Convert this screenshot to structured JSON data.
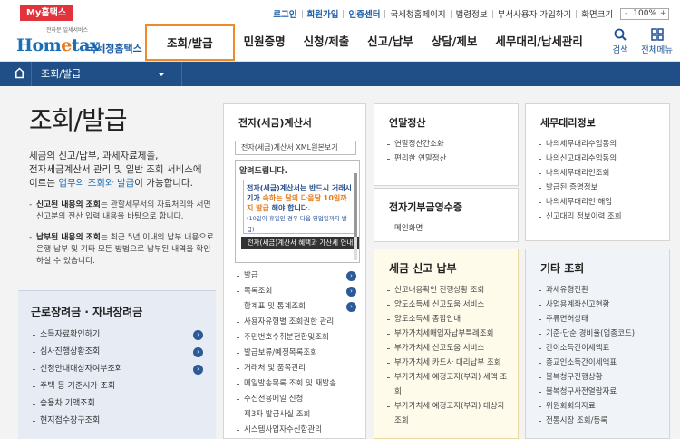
{
  "top": {
    "my_tab": "My홈택스",
    "links": [
      "로그인",
      "회원가입",
      "인증센터",
      "국세청홈페이지",
      "법령정보",
      "부서사용자 가입하기",
      "화면크기"
    ],
    "zoom_value": "100%",
    "zoom_minus": "-",
    "zoom_plus": "+"
  },
  "gnb": {
    "logo_small": "전하문 일세서비스",
    "logo_main_a": "Hom",
    "logo_main_e": "e",
    "logo_main_b": "tax",
    "logo_sub": "국세청홈택스",
    "menu": [
      "조회/발급",
      "민원증명",
      "신청/제출",
      "신고/납부",
      "상담/제보",
      "세무대리/납세관리"
    ],
    "search_label": "검색",
    "allmenu_label": "전체메뉴"
  },
  "location": {
    "title": "조회/발급"
  },
  "intro": {
    "title": "조회/발급",
    "desc_1": "세금의 신고/납부, 과세자료제출,",
    "desc_2": "전자세금계산서 관리 및 일반 조회 서비스에",
    "desc_3_a": "이르는 ",
    "desc_3_b": "업무의 조회와 발급",
    "desc_3_c": "이 가능합니다.",
    "bullet1_bold": "신고된 내용의 조회",
    "bullet1_text": "는 관할세무서의 자료처리와 서면신고분의 전산 입력 내용을 바탕으로 합니다.",
    "bullet2_bold": "납부된 내용의 조회",
    "bullet2_text": "는 최근 5년 이내의 납부 내용으로 은행 납부 및 기타 모든 방법으로 납부된 내역을 확인하실 수 있습니다."
  },
  "sub_box": {
    "title": "근로장려금 · 자녀장려금",
    "items": [
      "소득자료확인하기",
      "심사진행상황조회",
      "신청안내대상자여부조회",
      "주택 등 기준시가 조회",
      "승용차 기액조회",
      "현지접수장구조회"
    ]
  },
  "col1": {
    "title": "전자(세금)계산서",
    "search": "전자(세금)계산서 XML원본보기",
    "notice_title": "알려드립니다.",
    "notice_a": "전자(세금)계산서는 반드시 거래시기가 ",
    "notice_b": "속하는 달의 다음달 10일까지 발급",
    "notice_c": " 해야 합니다.",
    "notice_small": "(10일이 휴일인 경우 다음 영업일까지 발급)",
    "notice_bar": "전자(세금)계산서 혜택과 가산세 안내",
    "items": [
      "발급",
      "목록조회",
      "합계표 및 통계조회",
      "사용자유형별 조회권한 관리",
      "주민번호수취분전환및조회",
      "발급보류/예정목록조회",
      "거래처 및 품목관리",
      "메일발송목록 조회 및 재발송",
      "수신전용메일 신청",
      "제3자 발급사실 조회",
      "시스템사업자수신함관리"
    ]
  },
  "col2a": {
    "title": "연말정산",
    "items": [
      "연말정산간소화",
      "편리한 연말정산"
    ]
  },
  "col2b": {
    "title": "전자기부금영수증",
    "items": [
      "메인화면"
    ]
  },
  "col2c": {
    "title": "세금 신고 납부",
    "items": [
      "신고내용확인 진행상황 조회",
      "양도소득세 신고도움 서비스",
      "양도소득세 종합안내",
      "부가가치세매입자납부특례조회",
      "부가가치세 신고도움 서비스",
      "부가가치세 카드사 대리납부 조회",
      "부가가치세 예정고지(부과) 세액 조회",
      "부가가치세 예정고지(부과) 대상자 조회"
    ]
  },
  "col3a": {
    "title": "세무대리정보",
    "items": [
      "나의세무대리수임동의",
      "나의신고대리수임동의",
      "나의세무대리인조회",
      "발급된 증명정보",
      "나의세무대리인 해임",
      "신고대리 정보이력 조회"
    ]
  },
  "col3b": {
    "title": "기타 조회",
    "items": [
      "과세유형전환",
      "사업용계좌신고현황",
      "주류면허상태",
      "기준·단순 경비율(업종코드)",
      "간이소득간이세액표",
      "종교인소득간이세액표",
      "불복청구진행상황",
      "불복청구사전열람자료",
      "위원회회의자료",
      "전통시장 조회/등록"
    ]
  },
  "colors": {
    "brand_blue": "#1b6fb5",
    "nav_bar": "#1f4f86",
    "accent_orange": "#ee8a28",
    "my_tab_red": "#e2323c"
  }
}
